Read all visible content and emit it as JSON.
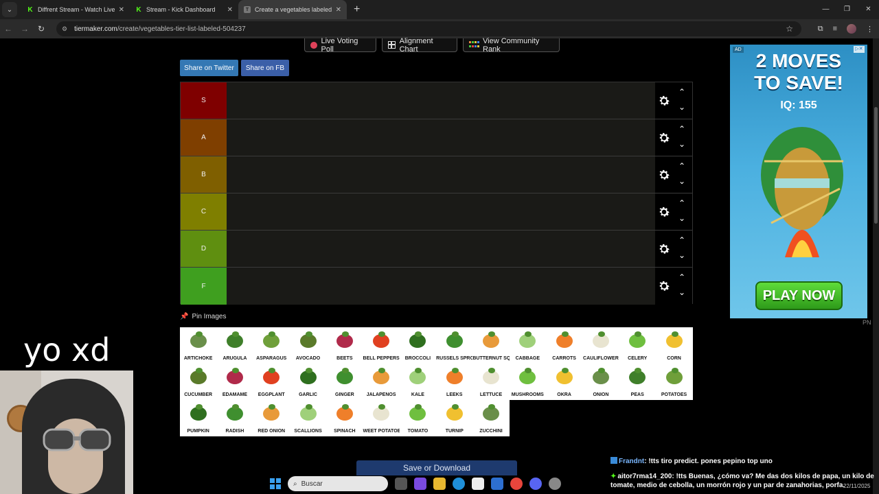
{
  "browser": {
    "tabs": [
      {
        "title": "Diffrent Stream - Watch Live on",
        "icon": "kick-icon"
      },
      {
        "title": "Stream - Kick Dashboard",
        "icon": "kick-icon"
      },
      {
        "title": "Create a vegetables labeled Tie",
        "icon": "tiermaker-icon",
        "active": true
      }
    ],
    "url_host": "tiermaker.com",
    "url_path": "/create/vegetables-tier-list-labeled-504237"
  },
  "page": {
    "top_buttons": [
      "Live Voting Poll",
      "Alignment Chart",
      "View Community Rank"
    ],
    "share": {
      "twitter": "Share on Twitter",
      "fb": "Share on FB"
    },
    "tiers": [
      {
        "label": "S",
        "color": "#7f0000"
      },
      {
        "label": "A",
        "color": "#7f3f00"
      },
      {
        "label": "B",
        "color": "#7f5f00"
      },
      {
        "label": "C",
        "color": "#7f7f00"
      },
      {
        "label": "D",
        "color": "#5f8f10"
      },
      {
        "label": "F",
        "color": "#3f9f1f"
      }
    ],
    "pin_label": "Pin Images",
    "vegetables": [
      [
        "ARTICHOKE",
        "ARUGULA",
        "ASPARAGUS",
        "AVOCADO",
        "BEETS",
        "BELL PEPPERS",
        "BROCCOLI",
        "RUSSELS SPROUT",
        "BUTTERNUT SQUAS",
        "CABBAGE",
        "CARROTS",
        "CAULIFLOWER",
        "CELERY",
        "CORN"
      ],
      [
        "CUCUMBER",
        "EDAMAME",
        "EGGPLANT",
        "GARLIC",
        "GINGER",
        "JALAPENOS",
        "KALE",
        "LEEKS",
        "LETTUCE",
        "MUSHROOMS",
        "OKRA",
        "ONION",
        "PEAS",
        "POTATOES"
      ],
      [
        "PUMPKIN",
        "RADISH",
        "RED ONION",
        "SCALLIONS",
        "SPINACH",
        "WEET POTATOE",
        "TOMATO",
        "TURNIP",
        "ZUCCHINI"
      ]
    ],
    "save_button": "Save or Download"
  },
  "ad": {
    "tag": "AD",
    "headline_1": "2 MOVES",
    "headline_2": "TO SAVE!",
    "iq": "IQ: 155",
    "cta": "PLAY NOW",
    "footer": "PN"
  },
  "overlay": {
    "caption": "yo xd",
    "chat": [
      {
        "user": "Frandnt",
        "text": ": !tts tiro predict. pones pepino top uno"
      },
      {
        "user": "aitor7rma14_200",
        "text": ": !tts Buenas, ¿cómo va? Me das dos kilos de papa, un kilo de tomate, medio de cebolla, un morrón rojo y un par de zanahorias, porfa."
      }
    ],
    "taskbar_search": "Buscar",
    "date": "22/11/2025"
  },
  "colors": {
    "veg": [
      "#6a8f4a",
      "#3f7f2a",
      "#6f9f3a",
      "#5a7a2a",
      "#b02a4a",
      "#e04020",
      "#2f6f1f",
      "#3f8f2f",
      "#e89a3a",
      "#9fd07a",
      "#ef7f2a",
      "#e8e4d0",
      "#6fbf3f",
      "#f0c030"
    ]
  }
}
